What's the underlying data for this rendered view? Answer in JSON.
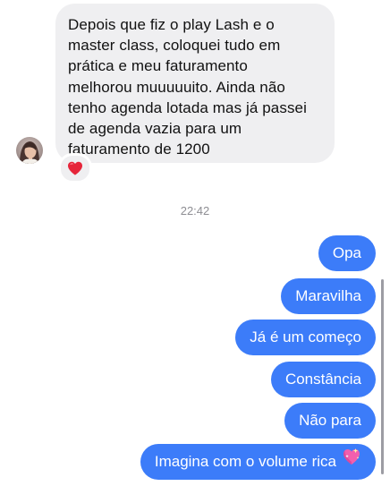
{
  "incoming": {
    "lines": [
      "Depois que fiz o play Lash e o",
      "master class, coloquei tudo em",
      "prática e meu faturamento",
      "melhorou muuuuuito. Ainda não",
      "tenho agenda lotada mas já passei",
      "de agenda vazia para um",
      "faturamento de 1200"
    ],
    "reaction_icon": "red-heart-icon"
  },
  "timestamp": "22:42",
  "outgoing": [
    {
      "text": "Opa"
    },
    {
      "text": "Maravilha"
    },
    {
      "text": "Já é um começo"
    },
    {
      "text": "Constância"
    },
    {
      "text": "Não para"
    },
    {
      "text": "Imagina com o volume rica",
      "emoji": "sparkling-heart-icon"
    }
  ],
  "colors": {
    "incoming_bubble": "#efeff1",
    "outgoing_bubble": "#3c7cf9",
    "timestamp": "#8e8e93"
  }
}
